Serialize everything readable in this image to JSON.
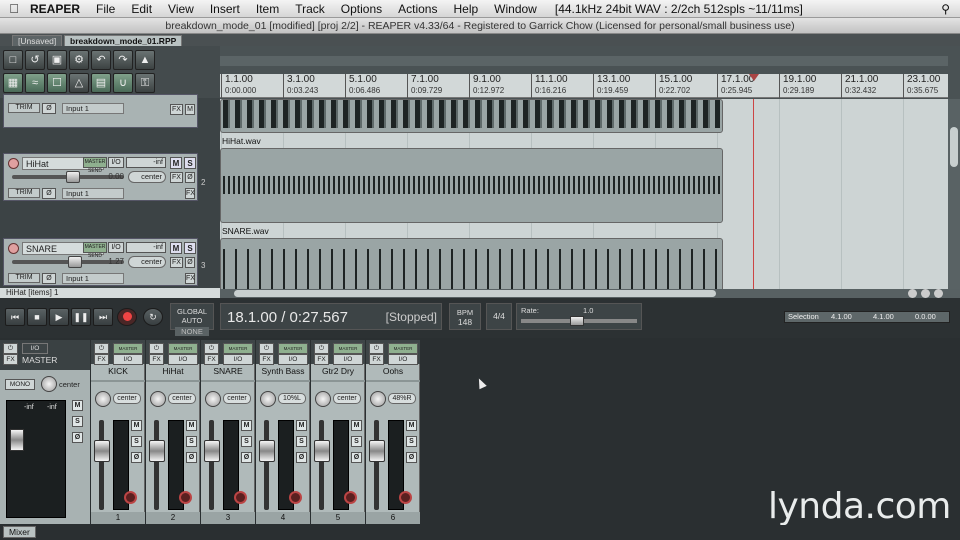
{
  "menubar": {
    "app_name": "REAPER",
    "items": [
      "File",
      "Edit",
      "View",
      "Insert",
      "Item",
      "Track",
      "Options",
      "Actions",
      "Help",
      "Window"
    ],
    "status": "[44.1kHz 24bit WAV : 2/2ch 512spls ~11/11ms]"
  },
  "window": {
    "title": "breakdown_mode_01 [modified] [proj 2/2] - REAPER v4.33/64 - Registered to Garrick Chow (Licensed for personal/small business use)"
  },
  "tabs": [
    {
      "label": "[Unsaved]"
    },
    {
      "label": "breakdown_mode_01.RPP"
    }
  ],
  "ruler": {
    "bars": [
      "1.1.00",
      "3.1.00",
      "5.1.00",
      "7.1.00",
      "9.1.00",
      "11.1.00",
      "13.1.00",
      "15.1.00",
      "17.1.00",
      "19.1.00",
      "21.1.00",
      "23.1.00"
    ],
    "times": [
      "0:00.000",
      "0:03.243",
      "0:06.486",
      "0:09.729",
      "0:12.972",
      "0:16.216",
      "0:19.459",
      "0:22.702",
      "0:25.945",
      "0:29.189",
      "0:32.432",
      "0:35.675"
    ]
  },
  "tracks": [
    {
      "name": "",
      "volume": "",
      "pan": "",
      "input": "Input 1",
      "number": ""
    },
    {
      "name": "HiHat",
      "volume": "0.00",
      "pan": "center",
      "input": "Input 1",
      "number": "2",
      "item": "HiHat.wav"
    },
    {
      "name": "SNARE",
      "volume": "1.27",
      "pan": "center",
      "input": "Input 1",
      "number": "3",
      "item": "SNARE.wav"
    }
  ],
  "tcp_labels": {
    "io": "I/O",
    "inf": "-inf",
    "mute": "M",
    "solo": "S",
    "fx": "FX",
    "phase": "Ø",
    "trim": "TRIM",
    "record_arm": "●",
    "master_send": "MASTER SEND"
  },
  "status_bar": "HiHat [items] 1",
  "transport": {
    "position": "18.1.00 / 0:27.567",
    "state": "[Stopped]",
    "global_auto": "GLOBAL AUTO",
    "global_auto_mode": "NONE",
    "bpm_label": "BPM",
    "bpm": "148",
    "time_sig": "4/4",
    "rate_label": "Rate:",
    "rate": "1.0",
    "selection_label": "Selection",
    "selection_start": "4.1.00",
    "selection_end": "4.1.00",
    "selection_length": "0.0.00"
  },
  "mixer": {
    "master": {
      "label": "MASTER",
      "mono": "MONO",
      "pan": "center",
      "io": "I/O",
      "fx": "FX",
      "meter_left": "-inf",
      "meter_right": "-inf"
    },
    "strip_labels": {
      "io": "I/O",
      "fx": "FX",
      "master_send": "MASTER SEND",
      "mute": "M",
      "solo": "S",
      "phase": "Ø"
    },
    "strips": [
      {
        "name": "KICK",
        "pan": "center",
        "number": "1"
      },
      {
        "name": "HiHat",
        "pan": "center",
        "number": "2"
      },
      {
        "name": "SNARE",
        "pan": "center",
        "number": "3"
      },
      {
        "name": "Synth Bass",
        "pan": "10%L",
        "number": "4"
      },
      {
        "name": "Gtr2 Dry",
        "pan": "center",
        "number": "5"
      },
      {
        "name": "Oohs",
        "pan": "48%R",
        "number": "6"
      }
    ],
    "tab": "Mixer"
  },
  "watermark": "lynda.com"
}
